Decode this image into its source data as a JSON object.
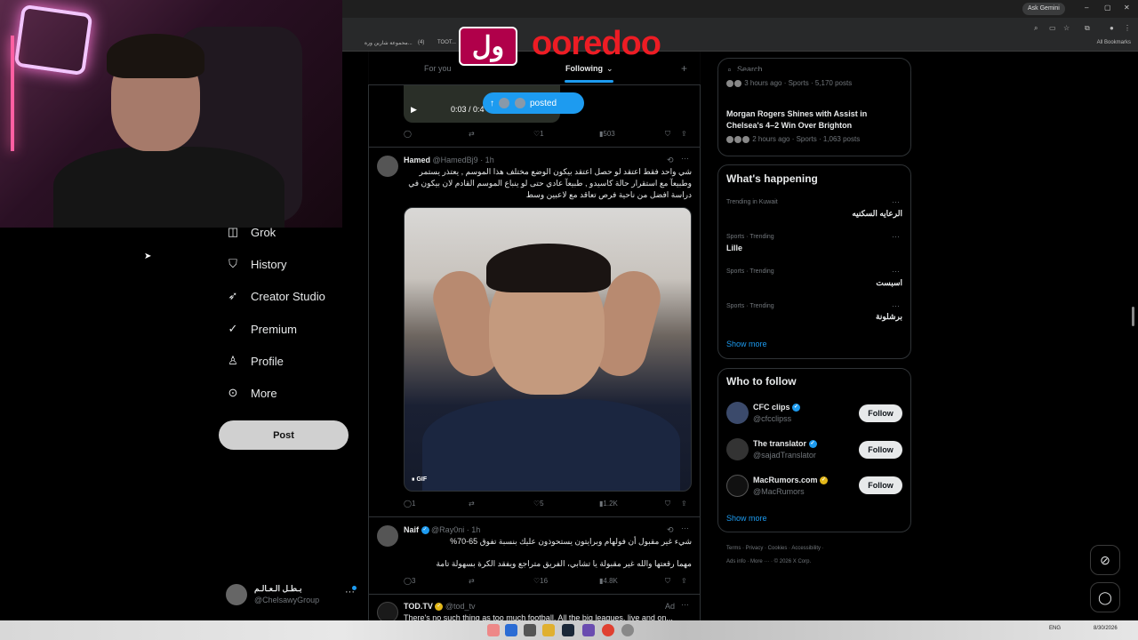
{
  "browser": {
    "ask_gemini": "Ask Gemini",
    "bookmarks": [
      "مكتبة (4)",
      "TOOT...",
      "محموعة شارين ورة...",
      "(4)"
    ],
    "all_bookmarks": "All Bookmarks",
    "minimize": "–",
    "restore": "▢",
    "close": "✕"
  },
  "overlay": {
    "brand": "ooredoo",
    "brand_ar": "ول"
  },
  "nav": {
    "items": [
      {
        "label": "Grok",
        "icon": "grok-icon"
      },
      {
        "label": "History",
        "icon": "bookmark-icon"
      },
      {
        "label": "Creator Studio",
        "icon": "rocket-icon"
      },
      {
        "label": "Premium",
        "icon": "verified-icon"
      },
      {
        "label": "Profile",
        "icon": "person-icon"
      },
      {
        "label": "More",
        "icon": "more-circle-icon"
      }
    ],
    "post_label": "Post",
    "account": {
      "name": "بـطـل الـعـالـم",
      "handle": "@ChelsawyGroup",
      "more": "···"
    }
  },
  "timeline": {
    "tabs": [
      "For you",
      "Following"
    ],
    "add_tab": "+",
    "top_video": {
      "time": "0:03 / 0:4",
      "posted_label": "posted"
    },
    "top_actions": {
      "reply": "",
      "repost": "",
      "like": "1",
      "views": "503"
    },
    "tweets": [
      {
        "name": "Hamed",
        "handle": "@HamedBj9 · 1h",
        "text": "شي واحد فقط اعتقد لو حصل اعتقد بيكون الوضع مختلف هذا الموسم , يعتذر يستمر وطبيعآ مع استقرار حالة كاسيدو , طبيعآ عادي حتى لو ينباع الموسم القادم لان بيكون في دراسة افضل من ناحية فرص تعاقد مع لاعبين وسط",
        "media_badge": "GIF",
        "actions": {
          "reply": "1",
          "repost": "",
          "like": "5",
          "views": "1.2K"
        }
      },
      {
        "name": "Naif",
        "handle": "@Ray0ni · 1h",
        "text_line1": "شيء غير مقبول أن فولهام وبرايتون يستحوذون عليك بنسبة تفوق 65-70%",
        "text_line2": "مهما رقعتها والله غير مقبولة يا تشابي، الفريق متراجع ويفقد الكرة بسهولة تامة",
        "actions": {
          "reply": "3",
          "repost": "",
          "like": "16",
          "views": "4.8K"
        }
      },
      {
        "name": "TOD.TV",
        "handle": "@tod_tv",
        "ad_label": "Ad",
        "text": "There's no such thing as too much football. All the big leagues, live and on..."
      }
    ]
  },
  "sidebar": {
    "search_placeholder": "Search",
    "news": [
      {
        "meta": "3 hours ago · Sports · 5,170 posts"
      },
      {
        "title": "Morgan Rogers Shines with Assist in Chelsea's 4–2 Win Over Brighton",
        "meta": "2 hours ago · Sports · 1,063 posts"
      }
    ],
    "whats_happening": {
      "title": "What's happening",
      "trends": [
        {
          "context": "Trending in Kuwait",
          "name": "الرعايه السكنيه"
        },
        {
          "context": "Sports · Trending",
          "name": "Lille"
        },
        {
          "context": "Sports · Trending",
          "name": "اسبست"
        },
        {
          "context": "Sports · Trending",
          "name": "برشلونة"
        }
      ],
      "show_more": "Show more"
    },
    "who_to_follow": {
      "title": "Who to follow",
      "accounts": [
        {
          "name": "CFC clips",
          "handle": "@cfcclipss",
          "badge": "blue"
        },
        {
          "name": "The translator",
          "handle": "@sajadTranslator",
          "badge": "blue"
        },
        {
          "name": "MacRumors.com",
          "handle": "@MacRumors",
          "badge": "gold"
        }
      ],
      "follow_label": "Follow",
      "show_more": "Show more"
    },
    "footer_line1": "Terms  ·  Privacy  ·  Cookies  ·  Accessibility  ·",
    "footer_line2": "Ads info  ·  More ···  ·  © 2026 X Corp."
  },
  "taskbar": {
    "lang": "ENG",
    "date": "8/30/2026"
  },
  "colors": {
    "accent": "#1d9bf0",
    "background": "#000000",
    "border": "#2f3336",
    "muted": "#71767b",
    "brand_red": "#ed1c24"
  }
}
